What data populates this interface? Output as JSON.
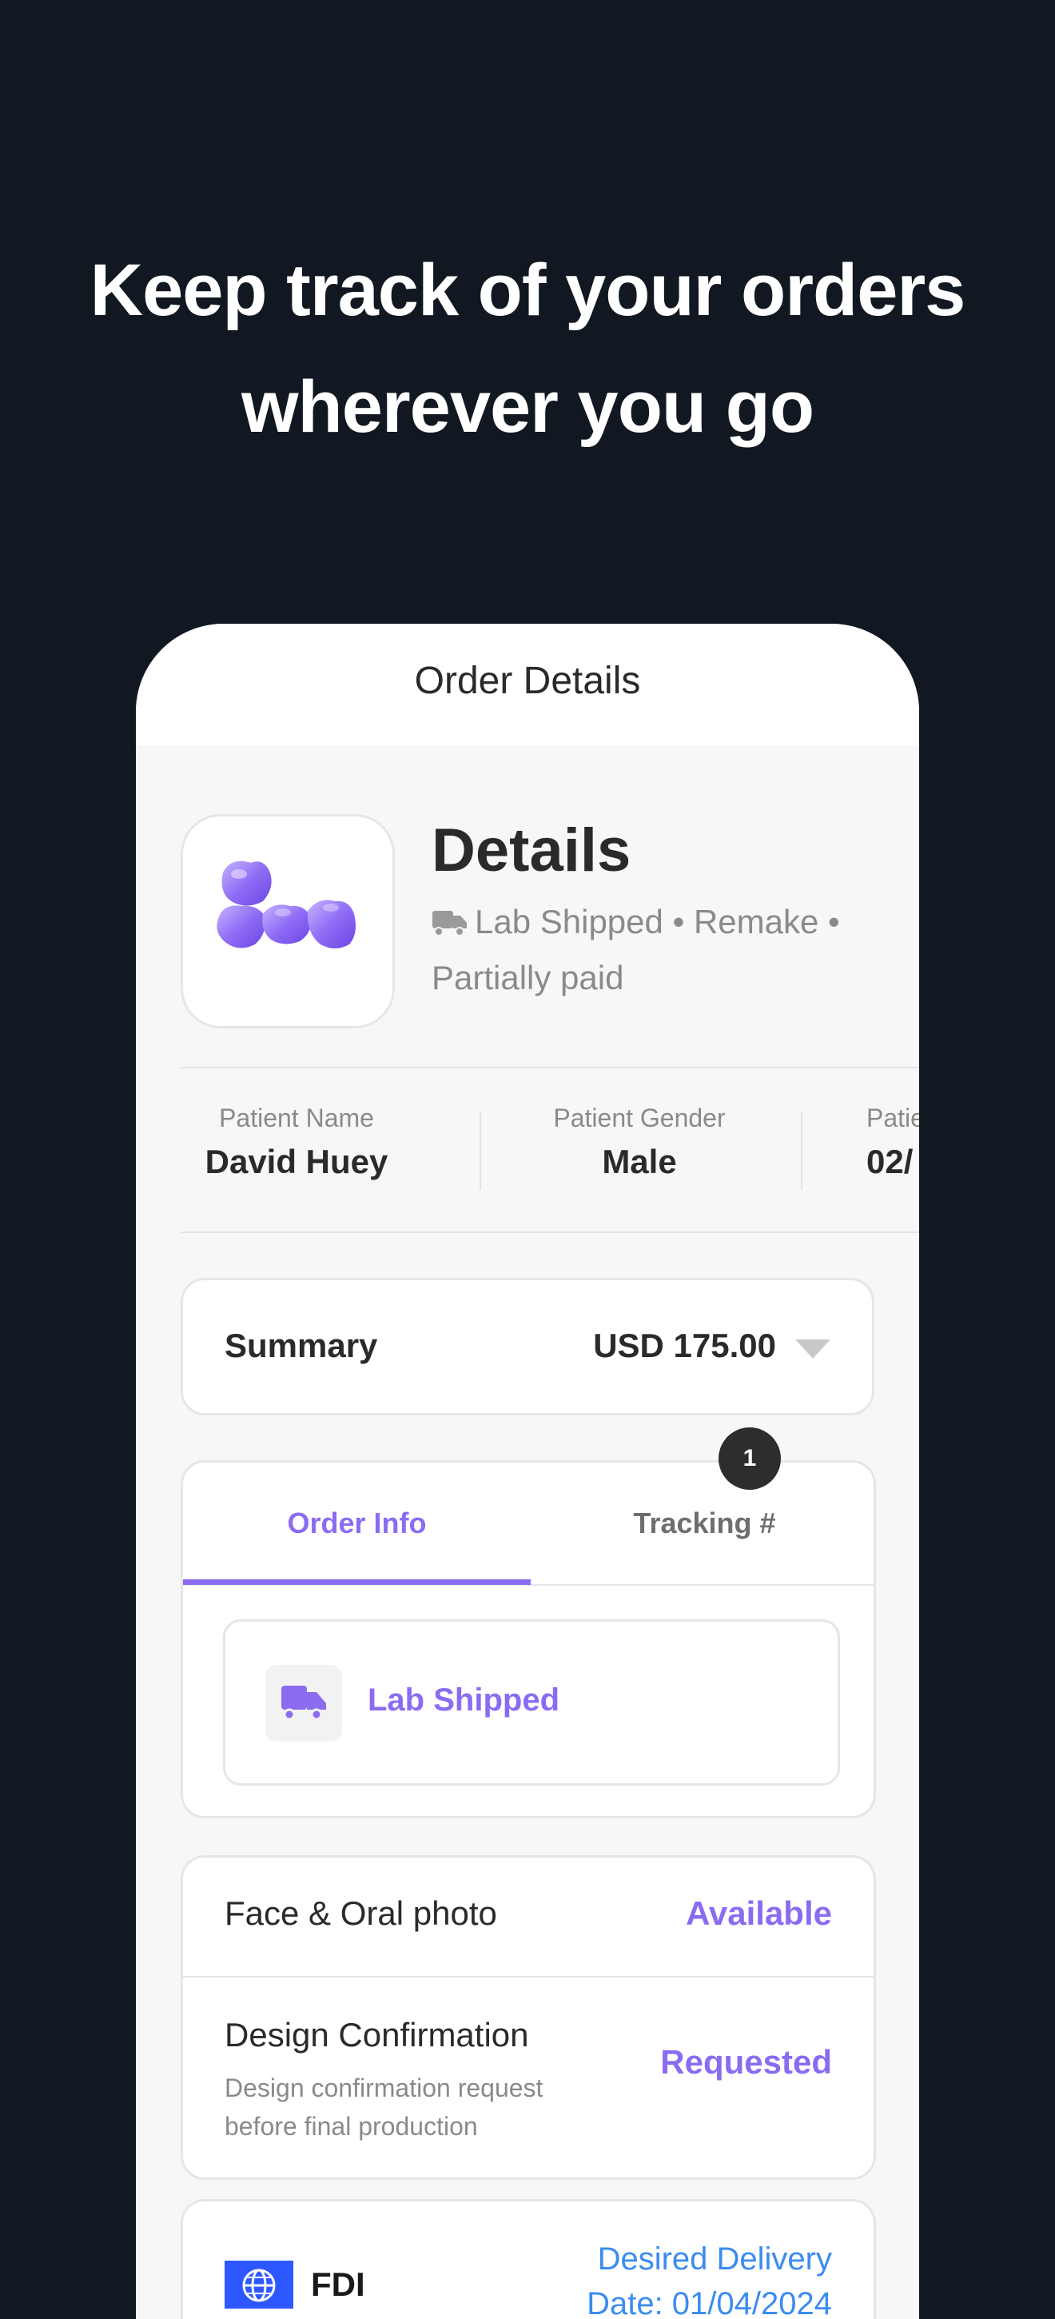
{
  "headline": {
    "line1": "Keep track of your orders",
    "line2": "wherever you go"
  },
  "nav": {
    "title": "Order Details"
  },
  "order": {
    "title": "Details",
    "status": "Lab Shipped",
    "type": "Remake",
    "payment": "Partially paid",
    "separator": "•"
  },
  "patient": {
    "name_label": "Patient Name",
    "name_value": "David Huey",
    "gender_label": "Patient Gender",
    "gender_value": "Male",
    "dob_label": "Patie",
    "dob_value": "02/"
  },
  "summary": {
    "label": "Summary",
    "amount": "USD 175.00"
  },
  "tabs": {
    "order_info": "Order Info",
    "tracking": "Tracking #",
    "tracking_badge": "1",
    "active": "Order Info"
  },
  "shipping": {
    "label": "Lab Shipped"
  },
  "items": {
    "face_oral": {
      "title": "Face & Oral photo",
      "status": "Available"
    },
    "design": {
      "title": "Design Confirmation",
      "subtitle": "Design confirmation request before final production",
      "status": "Requested"
    }
  },
  "fdi": {
    "label": "FDI",
    "delivery_line1": "Desired Delivery",
    "delivery_line2": "Date: 01/04/2024"
  },
  "colors": {
    "background": "#121821",
    "accent": "#8b6cf1",
    "link": "#3b8cf0",
    "flag": "#2e58ff"
  },
  "icons": [
    "truck-icon",
    "chevron-down-icon",
    "globe-icon",
    "dental-crown-image"
  ]
}
